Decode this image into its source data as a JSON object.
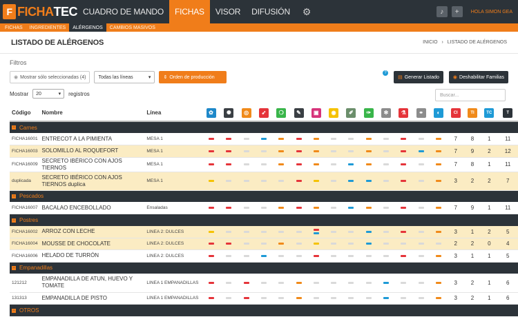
{
  "app": {
    "logo_a": "FICHA",
    "logo_b": "TEC",
    "logo_mark": "F"
  },
  "nav": [
    {
      "label": "CUADRO DE MANDO",
      "active": false
    },
    {
      "label": "FICHAS",
      "active": true
    },
    {
      "label": "VISOR",
      "active": false
    },
    {
      "label": "DIFUSIÓN",
      "active": false
    }
  ],
  "topbar": {
    "user": "HOLA SIMON GEA",
    "bell_icon": "bell-icon",
    "plus_icon": "plus-icon"
  },
  "subnav": [
    {
      "label": "FICHAS",
      "active": false
    },
    {
      "label": "INGREDIENTES",
      "active": false
    },
    {
      "label": "ALÉRGENOS",
      "active": true
    },
    {
      "label": "CAMBIOS MASIVOS",
      "active": false
    }
  ],
  "page": {
    "title": "LISTADO DE ALÉRGENOS",
    "breadcrumb_home": "INICIO",
    "breadcrumb_sep": "›",
    "breadcrumb_current": "LISTADO DE ALÉRGENOS"
  },
  "filters": {
    "title": "Filtros",
    "show_selected": "Mostrar sólo seleccionadas (4)",
    "lines_select": "Todas las líneas",
    "order_button": "Orden de producción",
    "generate_button": "Generar Listado",
    "disable_button": "Deshabilitar Familias",
    "show_label": "Mostrar",
    "show_value": "20",
    "records_label": "registros",
    "search_placeholder": "Buscar..."
  },
  "table": {
    "col_code": "Código",
    "col_name": "Nombre",
    "col_line": "Línea"
  },
  "allergen_icons": [
    {
      "name": "gluten-icon",
      "color": "#1e88c9",
      "glyph": "✿"
    },
    {
      "name": "crustaceans-icon",
      "color": "#3a3f44",
      "glyph": "✺"
    },
    {
      "name": "egg-icon",
      "color": "#f08a1a",
      "glyph": "◎"
    },
    {
      "name": "fish-icon",
      "color": "#e5343a",
      "glyph": "➶"
    },
    {
      "name": "peanut-icon",
      "color": "#39b54a",
      "glyph": "❍"
    },
    {
      "name": "soy-icon",
      "color": "#3a3f44",
      "glyph": "✎"
    },
    {
      "name": "milk-icon",
      "color": "#d6337a",
      "glyph": "▣"
    },
    {
      "name": "nuts-icon",
      "color": "#f5c200",
      "glyph": "◉"
    },
    {
      "name": "celery-icon",
      "color": "#6b8e6b",
      "glyph": "✐"
    },
    {
      "name": "mustard-icon",
      "color": "#39b54a",
      "glyph": "✑"
    },
    {
      "name": "sesame-icon",
      "color": "#8c8c8c",
      "glyph": "✻"
    },
    {
      "name": "sulphites-icon",
      "color": "#e5343a",
      "glyph": "⚗"
    },
    {
      "name": "lupin-icon",
      "color": "#8c8c8c",
      "glyph": "⚭"
    },
    {
      "name": "mollusc-icon",
      "color": "#1e9ad6",
      "glyph": "◐"
    }
  ],
  "count_headers": [
    {
      "label": "CI",
      "color": "#e5343a"
    },
    {
      "label": "TI",
      "color": "#f08a1a"
    },
    {
      "label": "TC",
      "color": "#1e9ad6"
    },
    {
      "label": "T",
      "color": "#2c3339"
    }
  ],
  "groups": [
    {
      "name": "Carnes",
      "rows": [
        {
          "code": "FICHA16001",
          "name": "ENTRECOT A LA PIMIENTA",
          "line": "MESA 1",
          "hl": false,
          "tall": false,
          "marks": [
            [
              "red"
            ],
            [
              "red"
            ],
            [
              "gry"
            ],
            [
              "blu"
            ],
            [
              "org"
            ],
            [
              "red"
            ],
            [
              "org"
            ],
            [
              "gry"
            ],
            [
              "gry"
            ],
            [
              "org"
            ],
            [
              "gry"
            ],
            [
              "red"
            ],
            [
              "gry"
            ],
            [
              "org"
            ]
          ],
          "counts": [
            "7",
            "8",
            "1",
            "11"
          ]
        },
        {
          "code": "FICHA16003",
          "name": "SOLOMILLO AL ROQUEFORT",
          "line": "MESA 1",
          "hl": true,
          "tall": false,
          "marks": [
            [
              "red"
            ],
            [
              "red"
            ],
            [
              "gry"
            ],
            [
              "gry"
            ],
            [
              "org"
            ],
            [
              "red"
            ],
            [
              "org"
            ],
            [
              "gry"
            ],
            [
              "gry"
            ],
            [
              "org"
            ],
            [
              "gry"
            ],
            [
              "red"
            ],
            [
              "blu"
            ],
            [
              "org"
            ]
          ],
          "counts": [
            "7",
            "9",
            "2",
            "12"
          ]
        },
        {
          "code": "FICHA16009",
          "name": "SECRETO IBÉRICO CON AJOS TIERNOS",
          "line": "MESA 1",
          "hl": false,
          "tall": false,
          "marks": [
            [
              "red"
            ],
            [
              "red"
            ],
            [
              "gry"
            ],
            [
              "gry"
            ],
            [
              "org"
            ],
            [
              "red"
            ],
            [
              "org"
            ],
            [
              "gry"
            ],
            [
              "blu"
            ],
            [
              "org"
            ],
            [
              "gry"
            ],
            [
              "red"
            ],
            [
              "gry"
            ],
            [
              "org"
            ]
          ],
          "counts": [
            "7",
            "8",
            "1",
            "11"
          ]
        },
        {
          "code": "duplicada",
          "name": "SECRETO IBÉRICO CON AJOS TIERNOS duplica",
          "line": "MESA 1",
          "hl": true,
          "tall": true,
          "marks": [
            [
              "yel"
            ],
            [
              "gry"
            ],
            [
              "gry"
            ],
            [
              "gry"
            ],
            [
              "gry"
            ],
            [
              "red"
            ],
            [
              "yel"
            ],
            [
              "gry"
            ],
            [
              "blu"
            ],
            [
              "blu"
            ],
            [
              "gry"
            ],
            [
              "red"
            ],
            [
              "gry"
            ],
            [
              "org"
            ]
          ],
          "counts": [
            "3",
            "2",
            "2",
            "7"
          ]
        }
      ]
    },
    {
      "name": "Pescados",
      "rows": [
        {
          "code": "FICHA16007",
          "name": "BACALAO ENCEBOLLADO",
          "line": "Ensaladas",
          "hl": false,
          "tall": false,
          "marks": [
            [
              "red"
            ],
            [
              "red"
            ],
            [
              "gry"
            ],
            [
              "gry"
            ],
            [
              "org"
            ],
            [
              "red"
            ],
            [
              "org"
            ],
            [
              "gry"
            ],
            [
              "blu"
            ],
            [
              "org"
            ],
            [
              "gry"
            ],
            [
              "red"
            ],
            [
              "gry"
            ],
            [
              "org"
            ]
          ],
          "counts": [
            "7",
            "9",
            "1",
            "11"
          ]
        }
      ]
    },
    {
      "name": "Postres",
      "rows": [
        {
          "code": "FICHA16002",
          "name": "ARROZ CON LECHE",
          "line": "LINEA 2: DULCES",
          "hl": true,
          "tall": false,
          "marks": [
            [
              "yel"
            ],
            [
              "gry"
            ],
            [
              "gry"
            ],
            [
              "gry"
            ],
            [
              "gry"
            ],
            [
              "gry"
            ],
            [
              "red",
              "blu"
            ],
            [
              "gry"
            ],
            [
              "gry"
            ],
            [
              "blu"
            ],
            [
              "gry"
            ],
            [
              "red"
            ],
            [
              "gry"
            ],
            [
              "org"
            ]
          ],
          "counts": [
            "3",
            "1",
            "2",
            "5"
          ]
        },
        {
          "code": "FICHA16004",
          "name": "MOUSSE DE CHOCOLATE",
          "line": "LINEA 2: DULCES",
          "hl": true,
          "tall": false,
          "marks": [
            [
              "red"
            ],
            [
              "red"
            ],
            [
              "gry"
            ],
            [
              "gry"
            ],
            [
              "org"
            ],
            [
              "gry"
            ],
            [
              "yel"
            ],
            [
              "gry"
            ],
            [
              "gry"
            ],
            [
              "blu"
            ],
            [
              "gry"
            ],
            [
              "gry"
            ],
            [
              "gry"
            ],
            [
              "gry"
            ]
          ],
          "counts": [
            "2",
            "2",
            "0",
            "4"
          ]
        },
        {
          "code": "FICHA16006",
          "name": "HELADO DE TURRÓN",
          "line": "LINEA 2: DULCES",
          "hl": false,
          "tall": false,
          "marks": [
            [
              "red"
            ],
            [
              "gry"
            ],
            [
              "gry"
            ],
            [
              "blu"
            ],
            [
              "gry"
            ],
            [
              "gry"
            ],
            [
              "red"
            ],
            [
              "gry"
            ],
            [
              "gry"
            ],
            [
              "gry"
            ],
            [
              "gry"
            ],
            [
              "red"
            ],
            [
              "gry"
            ],
            [
              "org"
            ]
          ],
          "counts": [
            "3",
            "1",
            "1",
            "5"
          ]
        }
      ]
    },
    {
      "name": "Empanadillas",
      "rows": [
        {
          "code": "121212",
          "name": "EMPANADILLA DE ATUN, HUEVO Y TOMATE",
          "line": "LINEA 1 EMPANADILLAS",
          "hl": false,
          "tall": true,
          "marks": [
            [
              "red"
            ],
            [
              "gry"
            ],
            [
              "red"
            ],
            [
              "gry"
            ],
            [
              "gry"
            ],
            [
              "org"
            ],
            [
              "gry"
            ],
            [
              "gry"
            ],
            [
              "gry"
            ],
            [
              "gry"
            ],
            [
              "blu"
            ],
            [
              "gry"
            ],
            [
              "gry"
            ],
            [
              "org"
            ]
          ],
          "counts": [
            "3",
            "2",
            "1",
            "6"
          ]
        },
        {
          "code": "131313",
          "name": "EMPANADILLA DE PISTO",
          "line": "LINEA 1 EMPANADILLAS",
          "hl": false,
          "tall": false,
          "marks": [
            [
              "red"
            ],
            [
              "gry"
            ],
            [
              "red"
            ],
            [
              "gry"
            ],
            [
              "gry"
            ],
            [
              "org"
            ],
            [
              "gry"
            ],
            [
              "gry"
            ],
            [
              "gry"
            ],
            [
              "gry"
            ],
            [
              "blu"
            ],
            [
              "gry"
            ],
            [
              "gry"
            ],
            [
              "org"
            ]
          ],
          "counts": [
            "3",
            "2",
            "1",
            "6"
          ]
        }
      ]
    },
    {
      "name": "OTROS",
      "rows": []
    }
  ]
}
